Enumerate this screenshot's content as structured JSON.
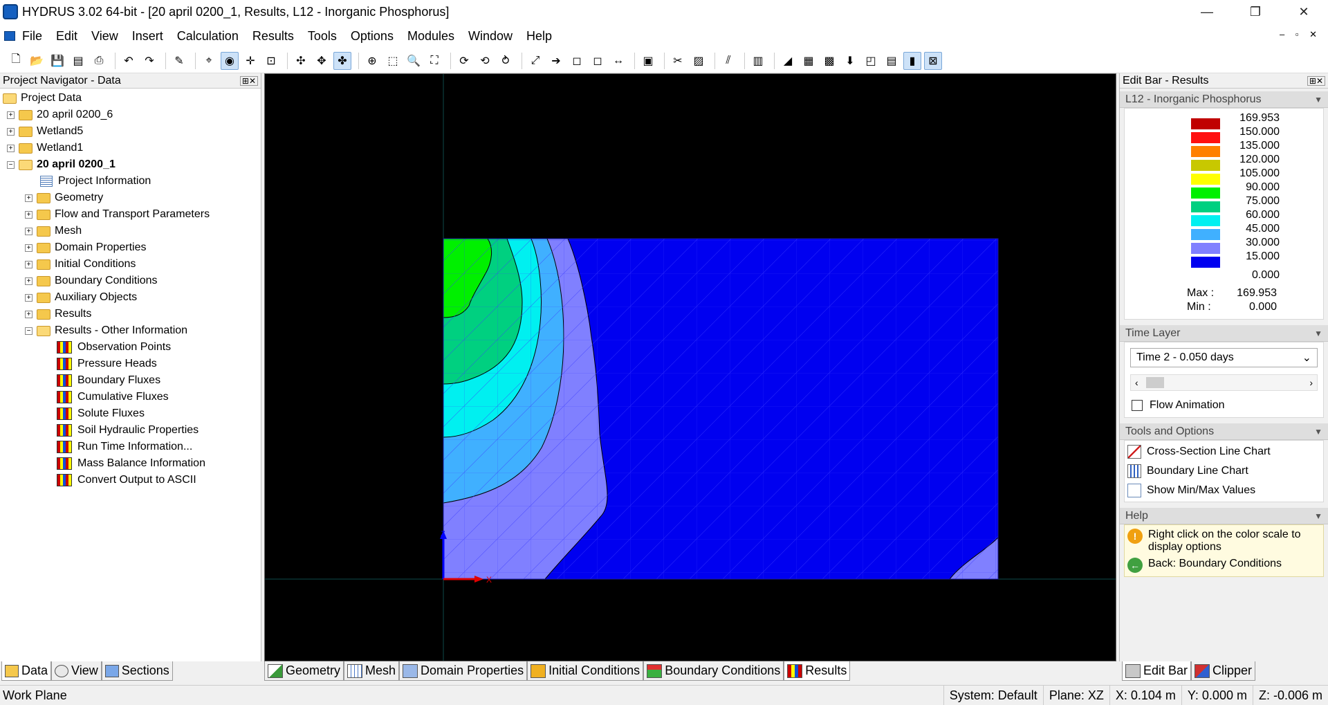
{
  "window": {
    "title": "HYDRUS 3.02 64-bit - [20 april 0200_1, Results, L12 - Inorganic Phosphorus]",
    "minimize": "—",
    "restore": "❐",
    "close": "✕"
  },
  "menu": {
    "items": [
      "File",
      "Edit",
      "View",
      "Insert",
      "Calculation",
      "Results",
      "Tools",
      "Options",
      "Modules",
      "Window",
      "Help"
    ],
    "mdi_controls": "– ▫ ✕"
  },
  "left_panel": {
    "header": "Project Navigator - Data",
    "pin": "⊞✕",
    "root": "Project Data",
    "projects": [
      "20 april 0200_6",
      "Wetland5",
      "Wetland1"
    ],
    "active_project": "20 april 0200_1",
    "project_info": "Project Information",
    "folders": [
      "Geometry",
      "Flow and Transport Parameters",
      "Mesh",
      "Domain Properties",
      "Initial Conditions",
      "Boundary Conditions",
      "Auxiliary Objects",
      "Results"
    ],
    "other_info_folder": "Results - Other Information",
    "results_items": [
      "Observation Points",
      "Pressure Heads",
      "Boundary Fluxes",
      "Cumulative Fluxes",
      "Solute Fluxes",
      "Soil Hydraulic Properties",
      "Run Time Information...",
      "Mass Balance Information",
      "Convert Output to ASCII"
    ],
    "tabs": [
      "Data",
      "View",
      "Sections"
    ]
  },
  "viewport": {
    "axis_z_label": "Z",
    "axis_x_label": "X",
    "colors": {
      "bg": "#000000",
      "c0": "#0000f0",
      "c15": "#8080ff",
      "c30": "#40b0ff",
      "c45": "#00f0f0",
      "c60": "#00d080",
      "c75": "#00f000"
    }
  },
  "bottom_tabs": [
    "Geometry",
    "Mesh",
    "Domain Properties",
    "Initial Conditions",
    "Boundary Conditions",
    "Results"
  ],
  "right_panel": {
    "header": "Edit Bar - Results",
    "legend_title": "L12 - Inorganic Phosphorus",
    "legend": [
      {
        "value": "169.953",
        "color": "#c00000"
      },
      {
        "value": "150.000",
        "color": "#ff1010"
      },
      {
        "value": "135.000",
        "color": "#ff8000"
      },
      {
        "value": "120.000",
        "color": "#c8c800"
      },
      {
        "value": "105.000",
        "color": "#ffff00"
      },
      {
        "value": "90.000",
        "color": "#00f000"
      },
      {
        "value": "75.000",
        "color": "#00d080"
      },
      {
        "value": "60.000",
        "color": "#00f0f0"
      },
      {
        "value": "45.000",
        "color": "#40b0ff"
      },
      {
        "value": "30.000",
        "color": "#8080ff"
      },
      {
        "value": "15.000",
        "color": "#0000f0"
      }
    ],
    "legend_min": "0.000",
    "max_label": "Max :",
    "max_value": "169.953",
    "min_label": "Min  :",
    "min_value": "0.000",
    "time_layer_header": "Time Layer",
    "time_layer_value": "Time 2 - 0.050 days",
    "flow_animation": "Flow Animation",
    "tools_header": "Tools and Options",
    "tools": [
      "Cross-Section Line Chart",
      "Boundary Line Chart",
      "Show Min/Max Values"
    ],
    "help_header": "Help",
    "help_items": [
      "Right click on the color scale to display options",
      "Back: Boundary Conditions"
    ],
    "tabs": [
      "Edit Bar",
      "Clipper"
    ]
  },
  "status": {
    "left": "Work Plane",
    "system": "System: Default",
    "plane": "Plane: XZ",
    "x": "X:  0.104 m",
    "y": "Y:  0.000 m",
    "z": "Z:  -0.006 m"
  }
}
